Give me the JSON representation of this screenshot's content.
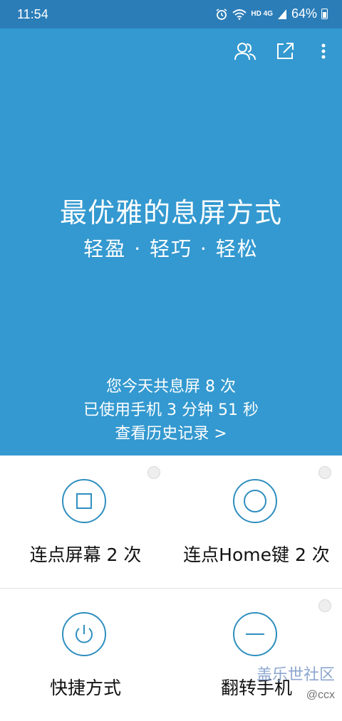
{
  "status_bar": {
    "time": "11:54",
    "network_small": "HD 4G",
    "battery_percent": "64%",
    "icons": [
      "alarm-icon",
      "wifi-icon",
      "signal-icon",
      "battery-icon"
    ]
  },
  "hero": {
    "title": "最优雅的息屏方式",
    "subtitle": "轻盈 · 轻巧 · 轻松",
    "stats_line1": "您今天共息屏 8 次",
    "stats_line2": "已使用手机 3 分钟 51 秒",
    "history_link": "查看历史记录 >",
    "actions": [
      "people-icon",
      "share-external-icon",
      "more-vert-icon"
    ],
    "background_color": "#3499d0"
  },
  "options": [
    {
      "label": "连点屏幕 2 次",
      "icon": "square-icon"
    },
    {
      "label": "连点Home键 2 次",
      "icon": "ring-icon"
    },
    {
      "label": "快捷方式",
      "icon": "power-icon"
    },
    {
      "label": "翻转手机",
      "icon": "minus-icon"
    }
  ],
  "watermark": {
    "text": "盖乐世社区",
    "handle": "@ccx"
  },
  "accent_color": "#2f8fbf"
}
